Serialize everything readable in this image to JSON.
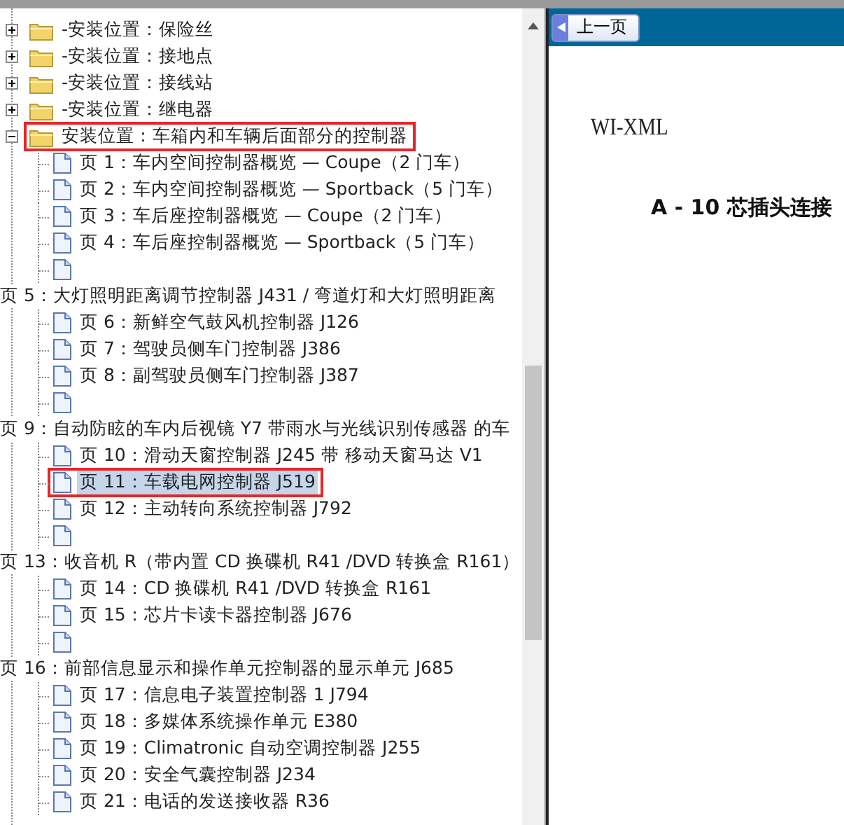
{
  "tree": {
    "items": [
      {
        "kind": "folder",
        "label": "-安装位置：保险丝",
        "expanded": false,
        "selected": false,
        "highlighted": false
      },
      {
        "kind": "folder",
        "label": "-安装位置：接地点",
        "expanded": false,
        "selected": false,
        "highlighted": false
      },
      {
        "kind": "folder",
        "label": "-安装位置：接线站",
        "expanded": false,
        "selected": false,
        "highlighted": false
      },
      {
        "kind": "folder",
        "label": "-安装位置：继电器",
        "expanded": false,
        "selected": false,
        "highlighted": false
      },
      {
        "kind": "folder",
        "label": "安装位置：车箱内和车辆后面部分的控制器",
        "expanded": true,
        "selected": false,
        "highlighted": true,
        "children": [
          {
            "kind": "page",
            "label": "页 1：车内空间控制器概览 — Coupe（2 门车）",
            "selected": false,
            "highlighted": false
          },
          {
            "kind": "page",
            "label": "页 2：车内空间控制器概览 — Sportback（5 门车）",
            "selected": false,
            "highlighted": false
          },
          {
            "kind": "page",
            "label": "页 3：车后座控制器概览 — Coupe（2 门车）",
            "selected": false,
            "highlighted": false
          },
          {
            "kind": "page",
            "label": "页 4：车后座控制器概览 — Sportback（5 门车）",
            "selected": false,
            "highlighted": false
          },
          {
            "kind": "blank"
          },
          {
            "kind": "heading",
            "label": "页 5：大灯照明距离调节控制器 J431 / 弯道灯和大灯照明距离"
          },
          {
            "kind": "page",
            "label": "页 6：新鲜空气鼓风机控制器 J126",
            "selected": false,
            "highlighted": false
          },
          {
            "kind": "page",
            "label": "页 7：驾驶员侧车门控制器 J386",
            "selected": false,
            "highlighted": false
          },
          {
            "kind": "page",
            "label": "页 8：副驾驶员侧车门控制器 J387",
            "selected": false,
            "highlighted": false
          },
          {
            "kind": "blank"
          },
          {
            "kind": "heading",
            "label": "页 9：自动防眩的车内后视镜 Y7 带雨水与光线识别传感器 的车"
          },
          {
            "kind": "page",
            "label": "页 10：滑动天窗控制器 J245 带 移动天窗马达 V1",
            "selected": false,
            "highlighted": false
          },
          {
            "kind": "page",
            "label": "页 11：车载电网控制器 J519",
            "selected": true,
            "highlighted": true
          },
          {
            "kind": "page",
            "label": "页 12：主动转向系统控制器 J792",
            "selected": false,
            "highlighted": false
          },
          {
            "kind": "blank"
          },
          {
            "kind": "heading",
            "label": "页 13：收音机 R（带内置 CD 换碟机 R41 /DVD 转换盒 R161）"
          },
          {
            "kind": "page",
            "label": "页 14：CD 换碟机 R41 /DVD 转换盒 R161",
            "selected": false,
            "highlighted": false
          },
          {
            "kind": "page",
            "label": "页 15：芯片卡读卡器控制器 J676",
            "selected": false,
            "highlighted": false
          },
          {
            "kind": "blank"
          },
          {
            "kind": "heading",
            "label": "页 16：前部信息显示和操作单元控制器的显示单元 J685"
          },
          {
            "kind": "page",
            "label": "页 17：信息电子装置控制器 1 J794",
            "selected": false,
            "highlighted": false
          },
          {
            "kind": "page",
            "label": "页 18：多媒体系统操作单元 E380",
            "selected": false,
            "highlighted": false
          },
          {
            "kind": "page",
            "label": "页 19：Climatronic 自动空调控制器 J255",
            "selected": false,
            "highlighted": false
          },
          {
            "kind": "page",
            "label": "页 20：安全气囊控制器 J234",
            "selected": false,
            "highlighted": false
          },
          {
            "kind": "page",
            "label": "页 21：电话的发送接收器 R36",
            "selected": false,
            "highlighted": false
          }
        ]
      }
    ]
  },
  "viewer": {
    "back_button": "上一页",
    "header": "WI-XML",
    "title": "A - 10 芯插头连接"
  }
}
